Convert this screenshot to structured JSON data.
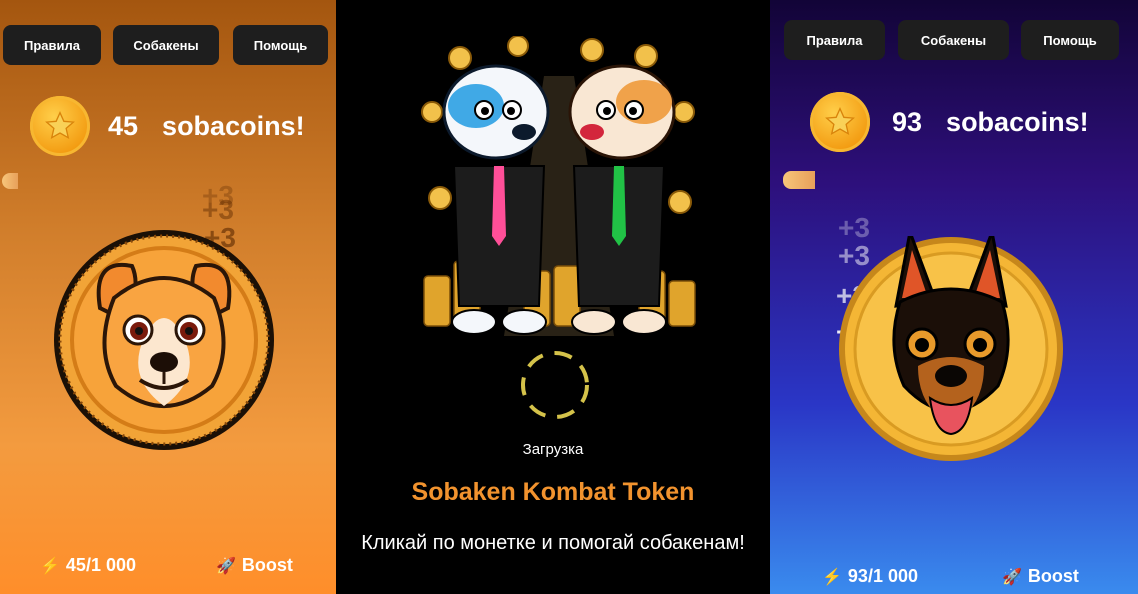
{
  "screens": [
    {
      "nav": [
        "Правила",
        "Собакены",
        "Помощь"
      ],
      "balance": {
        "amount": "45",
        "unit": "sobacoins!"
      },
      "float_text": [
        "+3",
        "+3",
        "+3",
        "+3"
      ],
      "energy": "45/1 000",
      "boost": "Boost"
    },
    {
      "loading": "Загрузка",
      "title": "Sobaken Kombat Token",
      "subtitle": "Кликай по монетке и помогай собакенам!"
    },
    {
      "nav": [
        "Правила",
        "Собакены",
        "Помощь"
      ],
      "balance": {
        "amount": "93",
        "unit": "sobacoins!"
      },
      "float_text": [
        "+3",
        "+3",
        "+3",
        "+3"
      ],
      "energy": "93/1 000",
      "boost": "Boost"
    }
  ],
  "colors": {
    "accent_orange": "#f39b3f",
    "title_orange": "#f2932e",
    "coin_gold": "#f7b731",
    "nav_bg": "#1e1e1e"
  },
  "icons": [
    "star-icon",
    "lightning-icon",
    "rocket-icon",
    "dog-coin-image",
    "two-dogs-image",
    "spinner-icon"
  ]
}
